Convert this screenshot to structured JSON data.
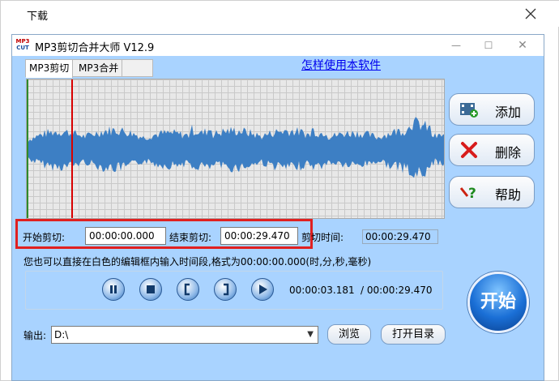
{
  "outer_window": {
    "title": "下载"
  },
  "app": {
    "title": "MP3剪切合并大师 V12.9",
    "icon_text_top": "MP3",
    "icon_text_bottom": "CUT",
    "tabs": [
      {
        "label": "MP3剪切"
      },
      {
        "label": "MP3合并"
      }
    ],
    "howto_link": "怎样使用本软件",
    "side_buttons": [
      {
        "label": "添加",
        "icon": "film-add-icon"
      },
      {
        "label": "删除",
        "icon": "delete-x-icon"
      },
      {
        "label": "帮助",
        "icon": "help-icon"
      }
    ],
    "cut": {
      "start_label": "开始剪切:",
      "start_value": "00:00:00.000",
      "end_label": "结束剪切:",
      "end_value": "00:00:29.470",
      "duration_label": "剪切时间:",
      "duration_value": "00:00:29.470"
    },
    "hint": "您也可以直接在白色的编辑框内输入时间段,格式为00:00:00.000(时,分,秒,毫秒)",
    "player": {
      "current_time": "00:00:03.181",
      "total_time": "/ 00:00:29.470"
    },
    "start_button": "开始",
    "output": {
      "label": "输出:",
      "path": "D:\\",
      "browse_label": "浏览",
      "open_dir_label": "打开目录"
    },
    "colors": {
      "accent": "#a9d3ff",
      "waveform": "#3d7fc4",
      "cursor": "#d80000",
      "highlight_frame": "#e02020"
    }
  }
}
